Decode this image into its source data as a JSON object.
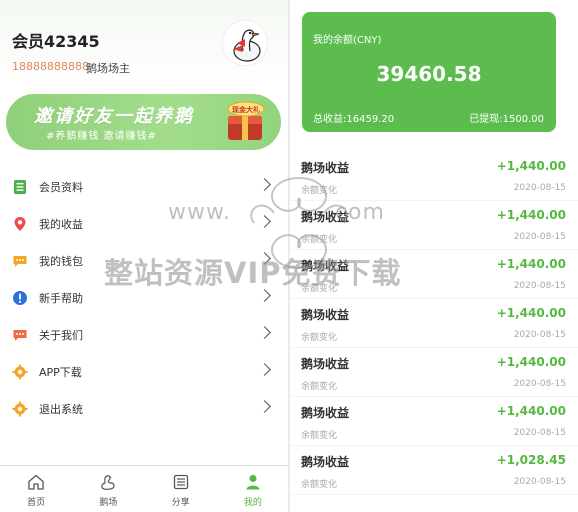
{
  "profile": {
    "name": "会员42345",
    "phone": "18888888888",
    "role": "鹅场场主"
  },
  "banner": {
    "title": "邀请好友一起养鹅",
    "subtitle": "#养鹅赚钱 邀请赚钱#",
    "badge_text": "现金大礼"
  },
  "menu": [
    {
      "label": "会员资料",
      "icon": "document-icon",
      "color": "#4caf50"
    },
    {
      "label": "我的收益",
      "icon": "location-pin-icon",
      "color": "#f04b4b"
    },
    {
      "label": "我的钱包",
      "icon": "wallet-chat-icon",
      "color": "#f5a623"
    },
    {
      "label": "新手帮助",
      "icon": "info-icon",
      "color": "#2f6fe0"
    },
    {
      "label": "关于我们",
      "icon": "chat-dots-icon",
      "color": "#f36a3e"
    },
    {
      "label": "APP下载",
      "icon": "gear-icon",
      "color": "#f5a623"
    },
    {
      "label": "退出系统",
      "icon": "gear-icon",
      "color": "#f5a623"
    }
  ],
  "tabs": [
    {
      "label": "首页",
      "icon": "home-icon"
    },
    {
      "label": "鹅场",
      "icon": "goose-icon"
    },
    {
      "label": "分享",
      "icon": "share-list-icon"
    },
    {
      "label": "我的",
      "icon": "user-icon",
      "active": true
    }
  ],
  "balance": {
    "label": "我的余额(CNY)",
    "amount": "39460.58",
    "total_income": "总收益:16459.20",
    "withdrawn": "已提现:1500.00"
  },
  "records": [
    {
      "title": "鹅场收益",
      "amount": "+1,440.00",
      "sub": "余额变化",
      "date": "2020-08-15"
    },
    {
      "title": "鹅场收益",
      "amount": "+1,440.00",
      "sub": "余额变化",
      "date": "2020-08-15"
    },
    {
      "title": "鹅场收益",
      "amount": "+1,440.00",
      "sub": "余额变化",
      "date": "2020-08-15"
    },
    {
      "title": "鹅场收益",
      "amount": "+1,440.00",
      "sub": "余额变化",
      "date": "2020-08-15"
    },
    {
      "title": "鹅场收益",
      "amount": "+1,440.00",
      "sub": "余额变化",
      "date": "2020-08-15"
    },
    {
      "title": "鹅场收益",
      "amount": "+1,440.00",
      "sub": "余额变化",
      "date": "2020-08-15"
    },
    {
      "title": "鹅场收益",
      "amount": "+1,028.45",
      "sub": "余额变化",
      "date": "2020-08-15"
    }
  ],
  "watermark": {
    "url": "www.",
    "url_tail": ".com",
    "text": "整站资源VIP免费下载"
  },
  "colors": {
    "accent_green": "#57b840",
    "card_green": "#5cbd4e",
    "phone_orange": "#e08a5a"
  }
}
